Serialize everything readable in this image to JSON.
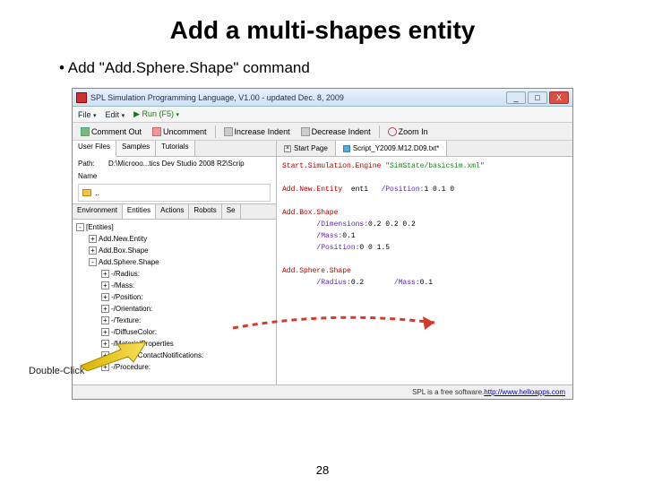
{
  "slide": {
    "title": "Add a multi-shapes entity",
    "bullet": "Add \"Add.Sphere.Shape\" command",
    "double_click_label": "Double-Click",
    "page_number": "28"
  },
  "window": {
    "title": "SPL Simulation Programming Language, V1.00 - updated Dec. 8, 2009",
    "btn_min": "_",
    "btn_max": "□",
    "btn_close": "X"
  },
  "menubar": {
    "file": "File",
    "edit": "Edit",
    "run": "Run (F5)"
  },
  "toolbar": {
    "comment_out": "Comment Out",
    "uncomment": "Uncomment",
    "increase_indent": "Increase Indent",
    "decrease_indent": "Decrease Indent",
    "zoom_in": "Zoom In"
  },
  "left_panel": {
    "tabs": {
      "user_files": "User Files",
      "samples": "Samples",
      "tutorials": "Tutorials"
    },
    "path_label": "Path:",
    "path_value": "D:\\Microoo...tics Dev Studio 2008 R2\\Scrip",
    "name_label": "Name",
    "folder_up": "..",
    "subtabs": {
      "environment": "Environment",
      "entities": "Entities",
      "actions": "Actions",
      "robots": "Robots",
      "sel": "Se"
    }
  },
  "tree": {
    "root": "[Entities]",
    "items": [
      "Add.New.Entity",
      "Add.Box.Shape",
      "Add.Sphere.Shape",
      "-/Radius:",
      "-/Mass:",
      "-/Position:",
      "-/Orientation:",
      "-/Texture:",
      "-/DiffuseColor:",
      "-/MaterialProperties",
      "-/EnableContactNotifications:",
      "-/Procedure:"
    ]
  },
  "right_panel": {
    "tabs": {
      "start": "Start Page",
      "script": "Script_Y2009.M12.D09.txt*"
    }
  },
  "code": {
    "l1_a": "Start.Simulation.Engine",
    "l1_b": "\"SimState/basicsim.xml\"",
    "l2_a": "Add.New.Entity",
    "l2_b": "ent1",
    "l2_c": "/Position:",
    "l2_d": "1 0.1 0",
    "l3_a": "Add.Box.Shape",
    "l3_b": "/Dimensions:",
    "l3_c": "0.2 0.2 0.2",
    "l3_d": "/Mass:",
    "l3_e": "0.1",
    "l3_f": "/Position:",
    "l3_g": "0 0  1.5",
    "l4_a": "Add.Sphere.Shape",
    "l4_b": "/Radius:",
    "l4_c": "0.2",
    "l4_d": "/Mass:",
    "l4_e": "0.1"
  },
  "status": {
    "text": "SPL is a free software.  ",
    "link": "http://www.helloapps.com"
  }
}
